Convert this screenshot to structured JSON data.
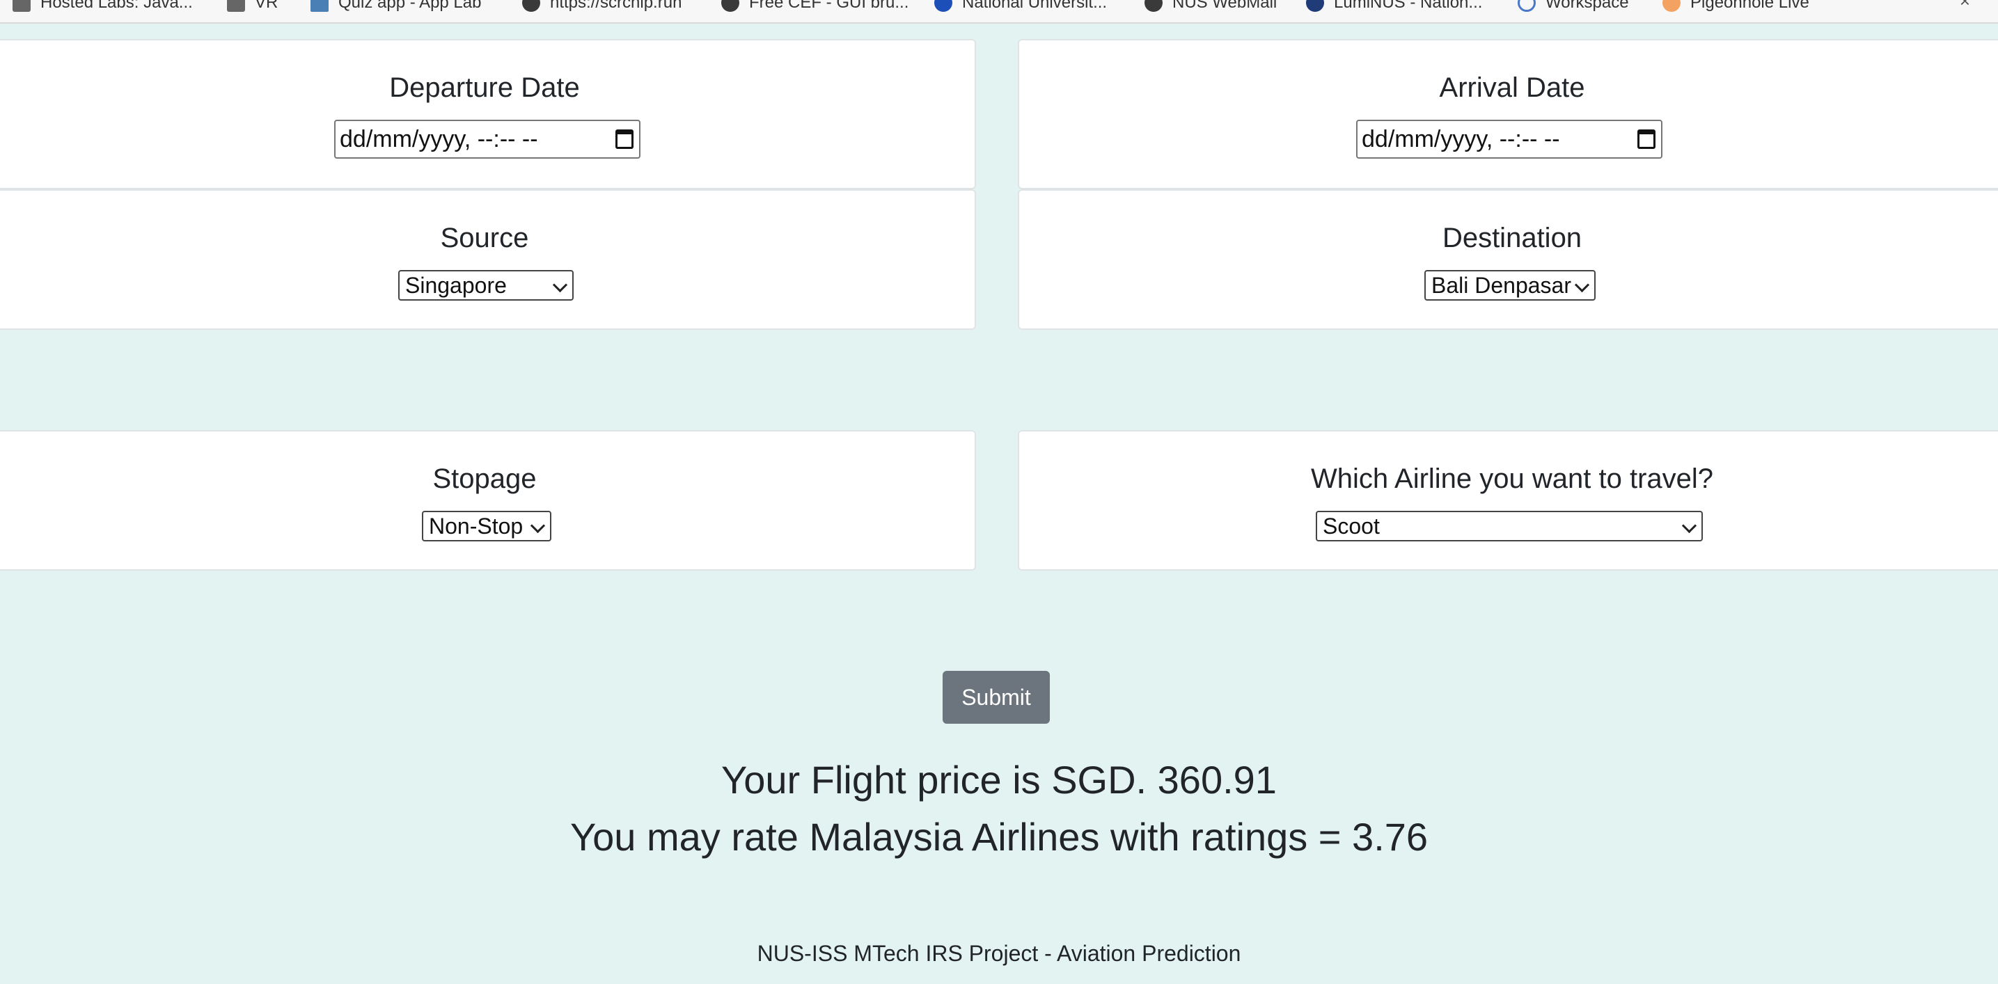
{
  "bookmarks": [
    {
      "label": "Hosted Labs: Java...",
      "icon": "logo-icon"
    },
    {
      "label": "VR",
      "icon": "folder-icon"
    },
    {
      "label": "Quiz app - App Lab",
      "icon": "app-lab-icon"
    },
    {
      "label": "https://scrchip.run",
      "icon": "globe-icon"
    },
    {
      "label": "Free CEF - GUI bru...",
      "icon": "globe-icon"
    },
    {
      "label": "National Universit...",
      "icon": "nus-icon"
    },
    {
      "label": "NUS WebMail",
      "icon": "globe-icon"
    },
    {
      "label": "LumiNUS - Nation...",
      "icon": "luminus-icon"
    },
    {
      "label": "Workspace",
      "icon": "workspace-icon"
    },
    {
      "label": "Pigeonhole Live",
      "icon": "pigeonhole-icon"
    }
  ],
  "bookmarks_close": "×",
  "form": {
    "departure": {
      "title": "Departure Date",
      "value": "dd/mm/yyyy, --:-- --"
    },
    "arrival": {
      "title": "Arrival Date",
      "value": "dd/mm/yyyy, --:-- --"
    },
    "source": {
      "title": "Source",
      "selected": "Singapore"
    },
    "destination": {
      "title": "Destination",
      "selected": "Bali Denpasar"
    },
    "stopage": {
      "title": "Stopage",
      "selected": "Non-Stop"
    },
    "airline": {
      "title": "Which Airline you want to travel?",
      "selected": "Scoot"
    }
  },
  "submit_label": "Submit",
  "result": {
    "price_line": "Your Flight price is SGD. 360.91",
    "rating_line": "You may rate Malaysia Airlines with ratings = 3.76"
  },
  "footer": "NUS-ISS MTech IRS Project - Aviation Prediction"
}
